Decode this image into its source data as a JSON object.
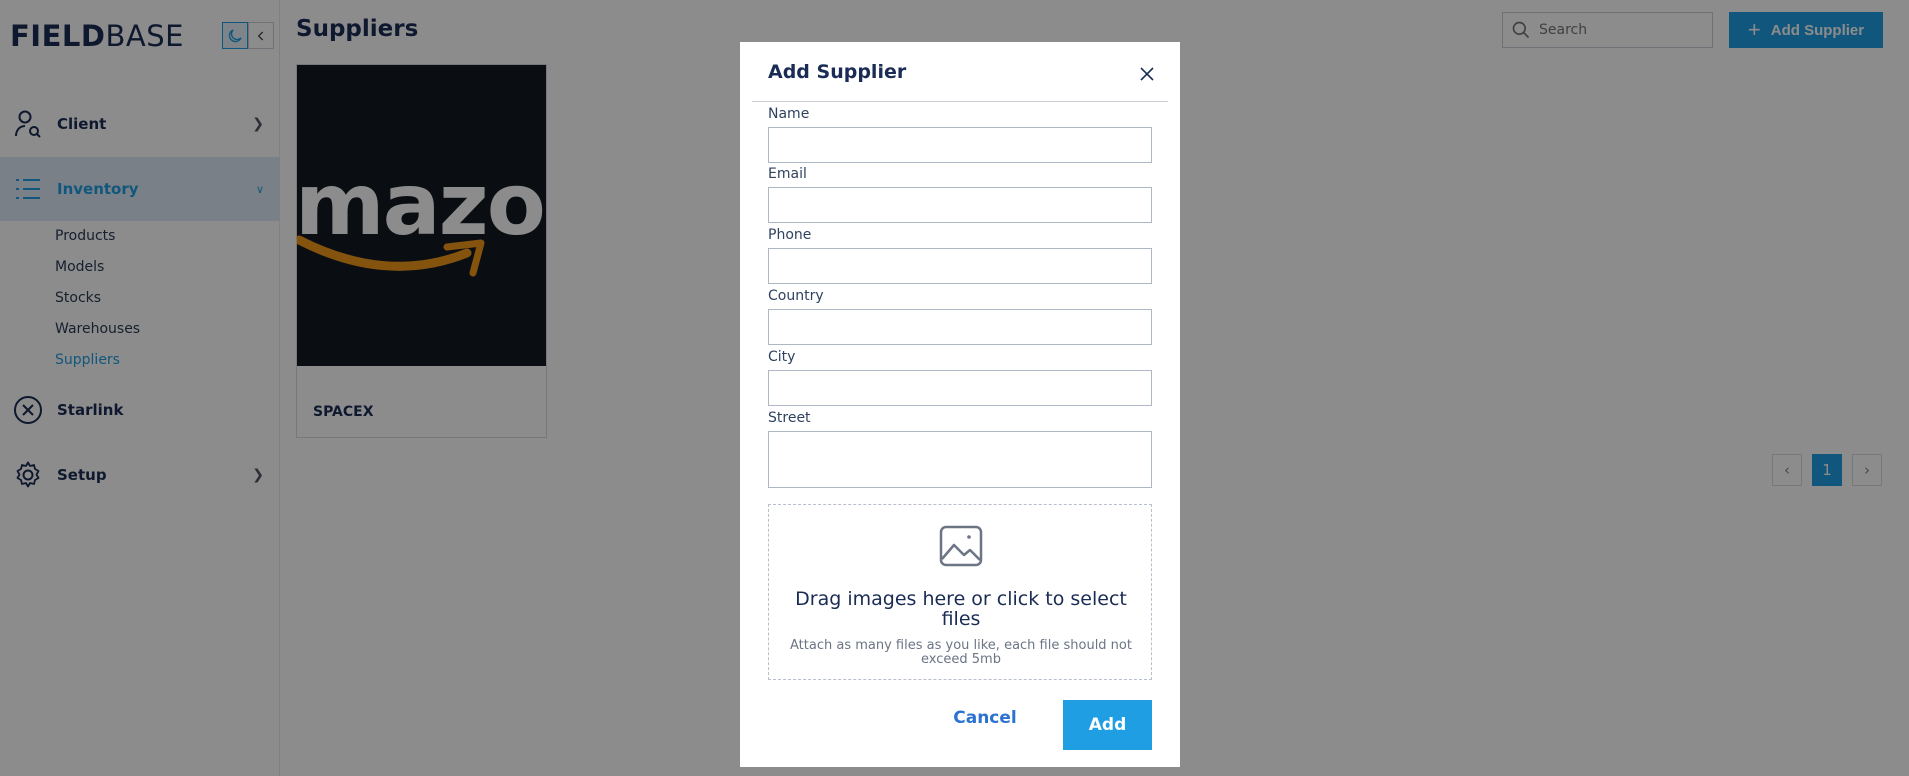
{
  "app": {
    "logo_part1": "FIELD",
    "logo_part2": "BASE",
    "brand_color": "#1f9ee3"
  },
  "sidebar": {
    "items": [
      {
        "label": "Client",
        "icon": "user-search-icon",
        "expanded": false
      },
      {
        "label": "Inventory",
        "icon": "list-icon",
        "expanded": true
      },
      {
        "label": "Starlink",
        "icon": "x-circle-icon"
      },
      {
        "label": "Setup",
        "icon": "gear-icon",
        "expanded": false
      }
    ],
    "inventory_sub": [
      "Products",
      "Models",
      "Stocks",
      "Warehouses",
      "Suppliers"
    ],
    "active_sub": "Suppliers"
  },
  "main": {
    "title": "Suppliers",
    "search_placeholder": "Search",
    "add_button_label": "Add Supplier",
    "cards": [
      {
        "name": "SPACEX",
        "image_text": "mazo"
      }
    ],
    "pagination": {
      "prev": "‹",
      "current": "1",
      "next": "›"
    }
  },
  "modal": {
    "title": "Add Supplier",
    "fields": {
      "name_label": "Name",
      "name_value": "",
      "email_label": "Email",
      "email_value": "",
      "phone_label": "Phone",
      "phone_value": "",
      "country_label": "Country",
      "country_value": "",
      "city_label": "City",
      "city_value": "",
      "street_label": "Street",
      "street_value": ""
    },
    "dropzone": {
      "main_text": "Drag images here or click to select files",
      "sub_text": "Attach as many files as you like, each file should not exceed 5mb"
    },
    "cancel_label": "Cancel",
    "submit_label": "Add"
  }
}
